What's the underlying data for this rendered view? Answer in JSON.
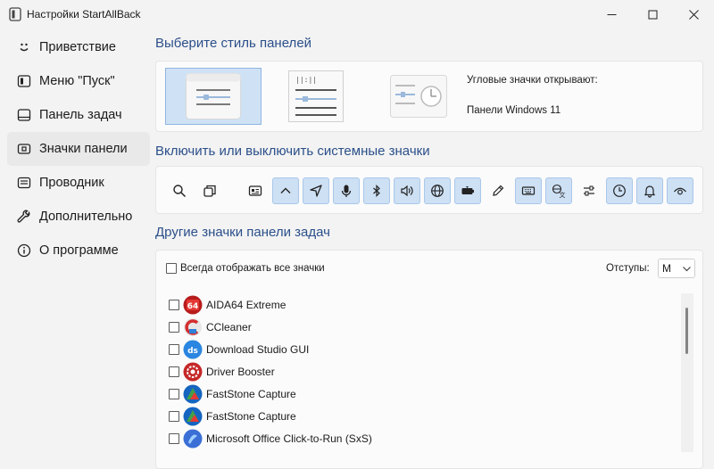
{
  "window": {
    "title": "Настройки StartAllBack"
  },
  "sidebar": {
    "items": [
      {
        "label": "Приветствие",
        "icon": "smile-icon",
        "active": false
      },
      {
        "label": "Меню \"Пуск\"",
        "icon": "start-menu-icon",
        "active": false
      },
      {
        "label": "Панель задач",
        "icon": "taskbar-icon",
        "active": false
      },
      {
        "label": "Значки панели",
        "icon": "tray-icons-icon",
        "active": true
      },
      {
        "label": "Проводник",
        "icon": "folder-icon",
        "active": false
      },
      {
        "label": "Дополнительно",
        "icon": "wrench-icon",
        "active": false
      },
      {
        "label": "О программе",
        "icon": "info-icon",
        "active": false
      }
    ]
  },
  "panel_style": {
    "heading": "Выберите стиль панелей",
    "options": [
      {
        "name": "style-windows11",
        "selected": true
      },
      {
        "name": "style-classic",
        "selected": false
      },
      {
        "name": "style-clock",
        "selected": false
      }
    ],
    "corner_label": "Угловые значки открывают:",
    "corner_value": "Панели Windows 11"
  },
  "system_icons": {
    "heading": "Включить или выключить системные значки",
    "icons": [
      {
        "name": "search-icon",
        "on": false
      },
      {
        "name": "task-view-icon",
        "on": false
      },
      {
        "name": "news-icon",
        "on": false
      },
      {
        "name": "chevron-up-icon",
        "on": true
      },
      {
        "name": "location-icon",
        "on": true
      },
      {
        "name": "microphone-icon",
        "on": true
      },
      {
        "name": "bluetooth-icon",
        "on": true
      },
      {
        "name": "volume-icon",
        "on": true
      },
      {
        "name": "network-icon",
        "on": true
      },
      {
        "name": "battery-icon",
        "on": true
      },
      {
        "name": "pen-icon",
        "on": false
      },
      {
        "name": "keyboard-icon",
        "on": true
      },
      {
        "name": "language-icon",
        "on": true
      },
      {
        "name": "settings-sliders-icon",
        "on": false
      },
      {
        "name": "clock-icon",
        "on": true
      },
      {
        "name": "bell-icon",
        "on": true
      },
      {
        "name": "eye-icon",
        "on": true
      }
    ]
  },
  "other_icons": {
    "heading": "Другие значки панели задач",
    "show_all_label": "Всегда отображать все значки",
    "show_all_checked": false,
    "spacing_label": "Отступы:",
    "spacing_value": "M",
    "apps": [
      {
        "label": "AIDA64 Extreme",
        "checked": false,
        "icon": "aida64-icon",
        "color": "#c62828"
      },
      {
        "label": "CCleaner",
        "checked": false,
        "icon": "ccleaner-icon",
        "color": "#d32f2f"
      },
      {
        "label": "Download Studio GUI",
        "checked": false,
        "icon": "download-studio-icon",
        "color": "#2a86e0"
      },
      {
        "label": "Driver Booster",
        "checked": false,
        "icon": "driver-booster-icon",
        "color": "#d32f2f"
      },
      {
        "label": "FastStone Capture",
        "checked": false,
        "icon": "faststone-icon",
        "color": "#1565c0"
      },
      {
        "label": "FastStone Capture",
        "checked": false,
        "icon": "faststone-icon",
        "color": "#1565c0"
      },
      {
        "label": "Microsoft Office Click-to-Run (SxS)",
        "checked": false,
        "icon": "office-icon",
        "color": "#3b6fd6"
      }
    ]
  }
}
